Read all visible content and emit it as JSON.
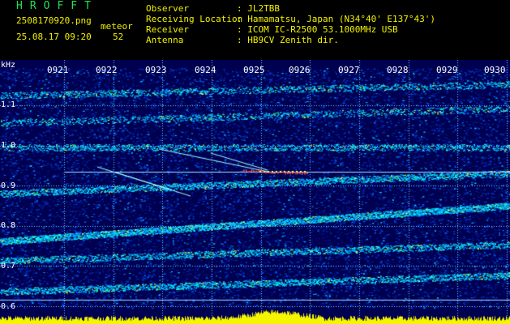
{
  "header": {
    "logo": "HROFFT",
    "filename": "2508170920.png",
    "mode_label": "meteor",
    "datetime": "25.08.17 09:20",
    "count": "52",
    "info": [
      {
        "key": "Observer",
        "value": ": JL2TBB"
      },
      {
        "key": "Receiving Location",
        "value": ": Hamamatsu, Japan (N34°40' E137°43')"
      },
      {
        "key": "Receiver",
        "value": ": ICOM IC-R2500 53.1000MHz USB"
      },
      {
        "key": "Antenna",
        "value": ": HB9CV Zenith dir."
      }
    ]
  },
  "spectrogram": {
    "unit_label": "kHz",
    "time_ticks": [
      "0921",
      "0922",
      "0923",
      "0924",
      "0925",
      "0926",
      "0927",
      "0928",
      "0929",
      "0930"
    ],
    "freq_ticks": [
      "1.1",
      "1.0",
      "0.9",
      "0.8",
      "0.7",
      "0.6"
    ],
    "colors": {
      "noise_low": "#000064",
      "noise_mid": "#0032c8",
      "signal": "#00ffff",
      "hot": "#ff2020",
      "grid": "#6fd3ff",
      "power": "#f5f500"
    }
  }
}
